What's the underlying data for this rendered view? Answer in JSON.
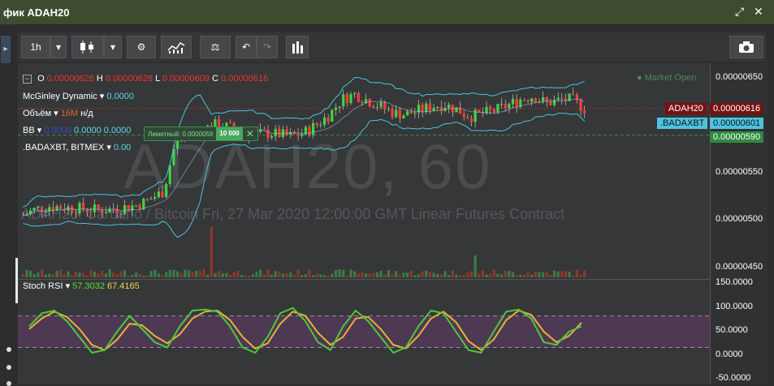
{
  "window": {
    "title": "фик ADAH20"
  },
  "toolbar": {
    "interval": "1h"
  },
  "ohlc": {
    "o_label": "O",
    "o": "0.00000628",
    "h_label": "H",
    "h": "0.00000628",
    "l_label": "L",
    "l": "0.00000609",
    "c_label": "C",
    "c": "0.00000616"
  },
  "indicators": {
    "mcginley": {
      "name": "McGinley Dynamic",
      "value": "0.0000"
    },
    "volume": {
      "name": "Объём",
      "value": "16M",
      "extra": "н/д"
    },
    "bb": {
      "name": "BB",
      "v1": "0.0000",
      "v2": "0.0000",
      "v3": "0.0000"
    },
    "badaxbt": {
      "name": ".BADAXBT, BITMEX",
      "value": "0.00"
    }
  },
  "market_status": "● Market Open",
  "watermark": {
    "symbol": "ADAH20, 60",
    "description": "ADAH20: Cardano / Bitcoin Fri, 27 Mar 2020 12:00:00 GMT Linear Futures Contract"
  },
  "order": {
    "label": "Лимитный: 0.0000059",
    "qty": "10 000",
    "close": "✕"
  },
  "price_axis": [
    "0.00000650",
    "0.00000550",
    "0.00000500",
    "0.00000450"
  ],
  "price_tags": {
    "adah20_name": "ADAH20",
    "adah20_value": "0.00000616",
    "badaxbt_name": ".BADAXBT",
    "badaxbt_value": "0.00000601",
    "order_value": "0.00000590"
  },
  "rsi": {
    "name": "Stoch RSI",
    "k": "57.3032",
    "d": "67.4165",
    "axis": [
      "150.0000",
      "100.0000",
      "50.0000",
      "0.0000",
      "-50.0000"
    ]
  },
  "colors": {
    "up": "#41d243",
    "down": "#ff3b3b",
    "bb": "#4ec3df",
    "rsi_k": "#4cc93a",
    "rsi_d": "#e3b23a",
    "rsi_band": "#5a3a60"
  },
  "chart_data": {
    "type": "candlestick",
    "price_ylim": [
      4.5e-06,
      6.6e-06
    ],
    "close_path": [
      5.12e-06,
      5.18e-06,
      5.21e-06,
      5.2e-06,
      5.19e-06,
      5.18e-06,
      5.17e-06,
      5.18e-06,
      5.2e-06,
      5.22e-06,
      5.28e-06,
      5.35e-06,
      5.86e-06,
      5.92e-06,
      5.95e-06,
      6e-06,
      5.98e-06,
      5.94e-06,
      5.9e-06,
      5.92e-06,
      5.91e-06,
      5.89e-06,
      5.92e-06,
      6e-06,
      6.1e-06,
      6.25e-06,
      6.3e-06,
      6.24e-06,
      6.18e-06,
      6.12e-06,
      6.1e-06,
      6.14e-06,
      6.18e-06,
      6.2e-06,
      6.15e-06,
      6.08e-06,
      6.11e-06,
      6.14e-06,
      6.19e-06,
      6.25e-06,
      6.28e-06,
      6.21e-06,
      6.24e-06,
      6.25e-06,
      6.16e-06
    ],
    "rsi_ylim": [
      -50,
      150
    ],
    "rsi_k": [
      60,
      85,
      90,
      70,
      40,
      10,
      15,
      50,
      80,
      55,
      30,
      20,
      60,
      90,
      92,
      88,
      60,
      20,
      10,
      40,
      85,
      95,
      70,
      30,
      15,
      60,
      90,
      70,
      40,
      10,
      20,
      60,
      90,
      85,
      50,
      15,
      10,
      50,
      88,
      92,
      75,
      30,
      25,
      50,
      60
    ],
    "rsi_d": [
      55,
      75,
      88,
      78,
      55,
      25,
      15,
      35,
      65,
      62,
      42,
      28,
      45,
      75,
      88,
      90,
      72,
      40,
      18,
      28,
      65,
      88,
      80,
      48,
      25,
      40,
      75,
      78,
      55,
      25,
      18,
      42,
      75,
      88,
      68,
      32,
      15,
      35,
      72,
      90,
      82,
      50,
      30,
      42,
      67
    ]
  }
}
